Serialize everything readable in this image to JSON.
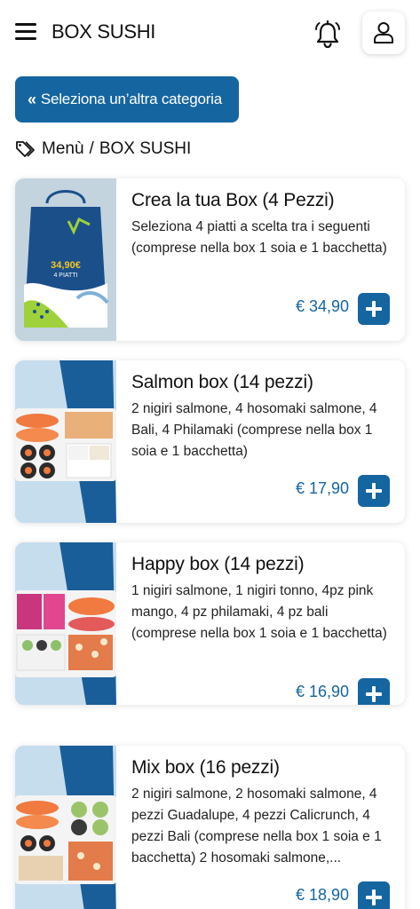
{
  "header": {
    "title": "BOX SUSHI",
    "menu_icon": "hamburger-menu-icon",
    "bell_icon": "bell-icon",
    "user_icon": "user-icon"
  },
  "back_button": {
    "label": "Seleziona un’altra categoria",
    "chevron": "«"
  },
  "breadcrumb": {
    "root": "Menù",
    "separator": "/",
    "current": "BOX SUSHI"
  },
  "products": [
    {
      "name": "Crea la tua Box (4 Pezzi)",
      "description": "Seleziona 4 piatti a scelta tra i seguenti (comprese nella box 1 soia e 1 bacchetta)",
      "price": "€ 34,90",
      "image_label_1": "34,90€",
      "image_label_2": "4 PIATTI"
    },
    {
      "name": "Salmon box (14 pezzi)",
      "description": "2 nigiri salmone, 4 hosomaki salmone, 4 Bali, 4 Philamaki (comprese nella box 1 soia e 1 bacchetta)",
      "price": "€ 17,90"
    },
    {
      "name": "Happy box (14 pezzi)",
      "description": "1 nigiri salmone, 1 nigiri tonno, 4pz pink mango, 4 pz philamaki, 4 pz bali (comprese nella box 1 soia e 1 bacchetta)",
      "price": "€ 16,90"
    },
    {
      "name": "Mix box (16 pezzi)",
      "description": "2 nigiri salmone, 2 hosomaki salmone, 4 pezzi Guadalupe, 4 pezzi Calicrunch, 4 pezzi Bali (comprese nella box 1 soia e 1 bacchetta) 2 hosomaki salmone,...",
      "price": "€ 18,90"
    }
  ],
  "colors": {
    "accent": "#1565a0",
    "image_bg": "#c6ddee"
  }
}
